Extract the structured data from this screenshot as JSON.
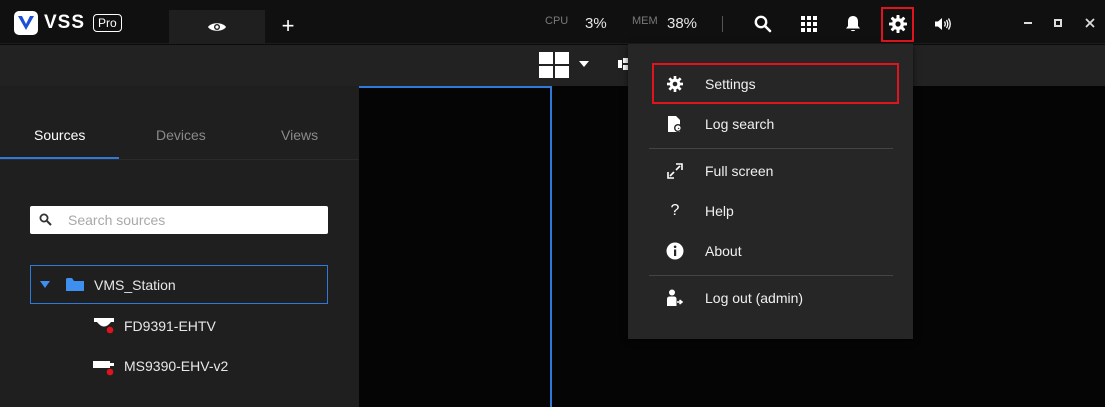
{
  "app": {
    "logo_text": "VSS",
    "logo_badge": "Pro"
  },
  "topbar": {
    "add_tab_label": "+",
    "cpu_label": "CPU",
    "cpu_value": "3%",
    "mem_label": "MEM",
    "mem_value": "38%",
    "icons": [
      "search-icon",
      "apps-grid-icon",
      "bell-icon",
      "gear-icon",
      "speaker-icon"
    ],
    "window_controls": [
      "minimize",
      "maximize",
      "close"
    ]
  },
  "sidebar": {
    "tabs": [
      {
        "label": "Sources",
        "active": true
      },
      {
        "label": "Devices",
        "active": false
      },
      {
        "label": "Views",
        "active": false
      }
    ],
    "search_placeholder": "Search sources",
    "tree": {
      "root": "VMS_Station",
      "children": [
        {
          "label": "FD9391-EHTV",
          "status_color": "#e0141e"
        },
        {
          "label": "MS9390-EHV-v2",
          "status_color": "#e0141e"
        }
      ]
    }
  },
  "menu": {
    "items": [
      {
        "label": "Settings",
        "icon": "gear-icon",
        "highlighted": true
      },
      {
        "label": "Log search",
        "icon": "log-search-icon"
      },
      {
        "label": "Full screen",
        "icon": "fullscreen-icon"
      },
      {
        "label": "Help",
        "icon": "help-icon",
        "glyph": "?"
      },
      {
        "label": "About",
        "icon": "info-icon"
      },
      {
        "label": "Log out (admin)",
        "icon": "logout-icon"
      }
    ]
  },
  "colors": {
    "accent": "#2f7ad9",
    "highlight": "#e0141e",
    "status_offline": "#e0141e"
  }
}
